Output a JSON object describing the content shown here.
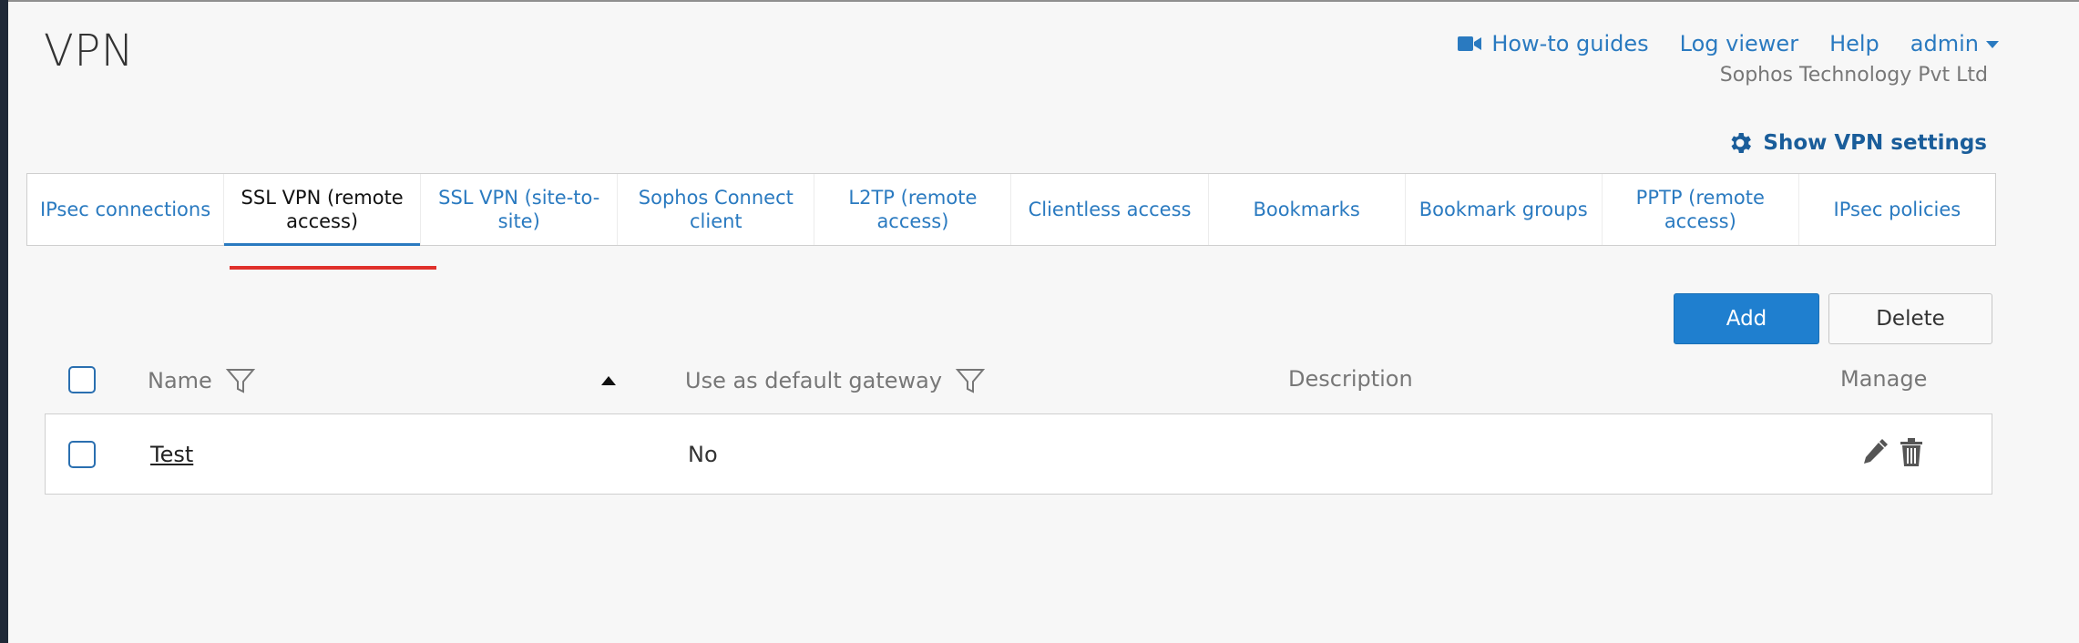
{
  "page": {
    "title": "VPN"
  },
  "header": {
    "how_to_guides": "How-to guides",
    "log_viewer": "Log viewer",
    "help": "Help",
    "admin": "admin",
    "company": "Sophos Technology Pvt Ltd"
  },
  "settings_link": "Show VPN settings",
  "tabs": [
    {
      "label": "IPsec connections",
      "active": false
    },
    {
      "label": "SSL VPN (remote access)",
      "active": true
    },
    {
      "label": "SSL VPN (site-to-site)",
      "active": false
    },
    {
      "label": "Sophos Connect client",
      "active": false
    },
    {
      "label": "L2TP (remote access)",
      "active": false
    },
    {
      "label": "Clientless access",
      "active": false
    },
    {
      "label": "Bookmarks",
      "active": false
    },
    {
      "label": "Bookmark groups",
      "active": false
    },
    {
      "label": "PPTP (remote access)",
      "active": false
    },
    {
      "label": "IPsec policies",
      "active": false
    }
  ],
  "actions": {
    "add": "Add",
    "delete": "Delete"
  },
  "table": {
    "columns": {
      "name": "Name",
      "default_gateway": "Use as default gateway",
      "description": "Description",
      "manage": "Manage"
    },
    "rows": [
      {
        "name": "Test",
        "default_gateway": "No",
        "description": ""
      }
    ]
  },
  "colors": {
    "accent": "#2a7ac0",
    "primary_button": "#1f7fcf",
    "highlight": "#e0302b"
  },
  "icons": [
    "video-camera-icon",
    "caret-down-icon",
    "gear-icon",
    "filter-icon",
    "sort-up-icon",
    "pencil-icon",
    "trash-icon"
  ]
}
